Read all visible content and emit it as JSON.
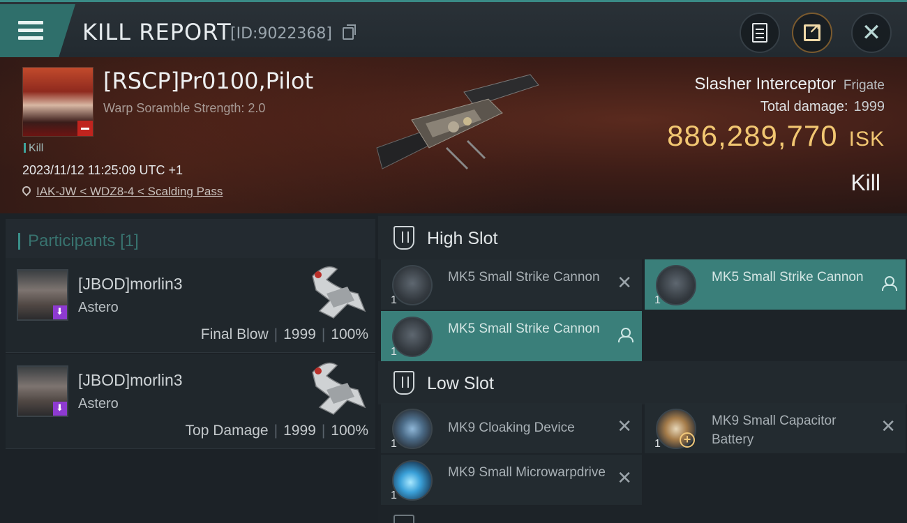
{
  "header": {
    "title": "KILL REPORT",
    "report_id": "[ID:9022368]"
  },
  "victim": {
    "pilot_name": "[RSCP]Pr0100,Pilot",
    "subtitle": "Warp Soramble Strength: 2.0",
    "kill_tag": "Kill",
    "timestamp": "2023/11/12 11:25:09 UTC +1",
    "location": "IAK-JW < WDZ8-4 < Scalding Pass",
    "ship_name": "Slasher Interceptor",
    "ship_class": "Frigate",
    "total_damage_label": "Total damage:",
    "total_damage": "1999",
    "isk_value": "886,289,770",
    "isk_unit": "ISK",
    "result": "Kill"
  },
  "participants": {
    "label": "Participants",
    "count": "[1]",
    "rows": [
      {
        "name": "[JBOD]morlin3",
        "ship": "Astero",
        "role": "Final Blow",
        "damage": "1999",
        "percent": "100%"
      },
      {
        "name": "[JBOD]morlin3",
        "ship": "Astero",
        "role": "Top Damage",
        "damage": "1999",
        "percent": "100%"
      }
    ]
  },
  "high_slot": {
    "label": "High Slot",
    "modules": [
      {
        "name": "MK5 Small Strike Cannon",
        "qty": "1",
        "status": "destroyed"
      },
      {
        "name": "MK5 Small Strike Cannon",
        "qty": "1",
        "status": "dropped"
      },
      {
        "name": "MK5 Small Strike Cannon",
        "qty": "1",
        "status": "dropped"
      }
    ]
  },
  "low_slot": {
    "label": "Low Slot",
    "modules": [
      {
        "name": "MK9 Cloaking Device",
        "qty": "1",
        "status": "destroyed"
      },
      {
        "name": "MK9 Small Capacitor Battery",
        "qty": "1",
        "status": "destroyed"
      },
      {
        "name": "MK9 Small Microwarpdrive",
        "qty": "1",
        "status": "destroyed"
      }
    ]
  },
  "colors": {
    "accent_teal": "#3a7f7a",
    "isk_gold": "#f2c772",
    "badge_purple": "#8e3ad1"
  }
}
